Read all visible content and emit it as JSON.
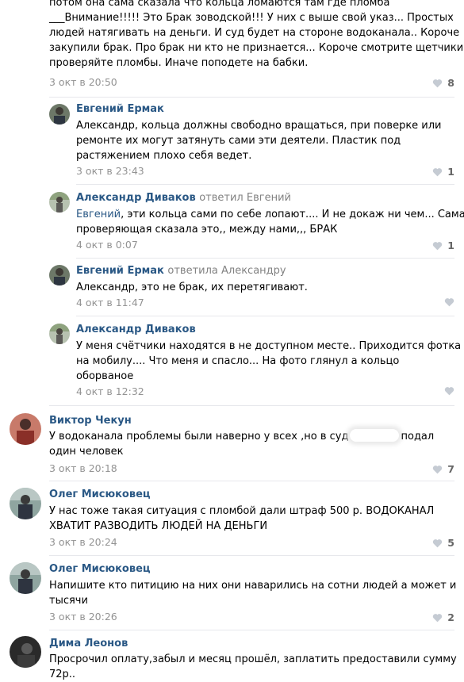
{
  "comments": [
    {
      "lines": [
        "потом она сама сказала что кольца ломаются там где пломба",
        "___Внимание!!!!! Это Брак зоводской!!! У них с выше свой указ... Простых",
        "людей натягивать на деньги. И суд будет на стороне водоканала.. Короче",
        "закупили брак. Про брак ни кто не признается... Короче смотрите щетчики",
        "проверяйте пломбы. Иначе поподете на бабки."
      ],
      "date": "3 окт в 20:50",
      "likes": "8"
    },
    {
      "author": "Евгений Ермак",
      "lines": [
        "Александр, кольца должны свободно вращаться, при поверке или",
        "ремонте их могут затянуть сами эти деятели. Пластик под",
        "растяжением плохо себя ведет."
      ],
      "date": "3 окт в 23:43",
      "likes": "1"
    },
    {
      "author": "Александр Диваков",
      "reply_to": "ответил Евгений",
      "mention": "Евгений",
      "line1_rest": ", эти кольца сами по себе лопают.... И не докаж ни чем... Сама",
      "line2": "проверяющая сказала это,, между нами,,, БРАК",
      "date": "4 окт в 0:07",
      "likes": "1"
    },
    {
      "author": "Евгений Ермак",
      "reply_to": "ответила Александру",
      "lines": [
        "Александр, это не брак, их перетягивают."
      ],
      "date": "4 окт в 11:47"
    },
    {
      "author": "Александр Диваков",
      "lines": [
        "У меня счётчики находятся в не доступном месте.. Приходится фотка",
        "на мобилу.... Что меня и спасло... На фото глянул а кольцо",
        "оборваное"
      ],
      "date": "4 окт в 12:32"
    },
    {
      "author": "Виктор Чекун",
      "line1_before": "У водоканала проблемы были наверно у всех ,но в суд",
      "line1_after": "подал",
      "line2": "один человек",
      "date": "3 окт в 20:18",
      "likes": "7"
    },
    {
      "author": "Олег Мисюковец",
      "lines": [
        "У нас тоже такая ситуация с пломбой дали штраф 500 р. ВОДОКАНАЛ",
        "ХВАТИТ РАЗВОДИТЬ ЛЮДЕЙ НА ДЕНЬГИ"
      ],
      "date": "3 окт в 20:24",
      "likes": "5"
    },
    {
      "author": "Олег Мисюковец",
      "lines": [
        "Напишите кто питицию на них они наварились на сотни людей а может и",
        "тысячи"
      ],
      "date": "3 окт в 20:26",
      "likes": "2"
    },
    {
      "author": "Дима Леонов",
      "lines": [
        "Просрочил оплату,забыл и месяц прошёл, заплатить предоставили сумму",
        "72р.."
      ]
    }
  ]
}
